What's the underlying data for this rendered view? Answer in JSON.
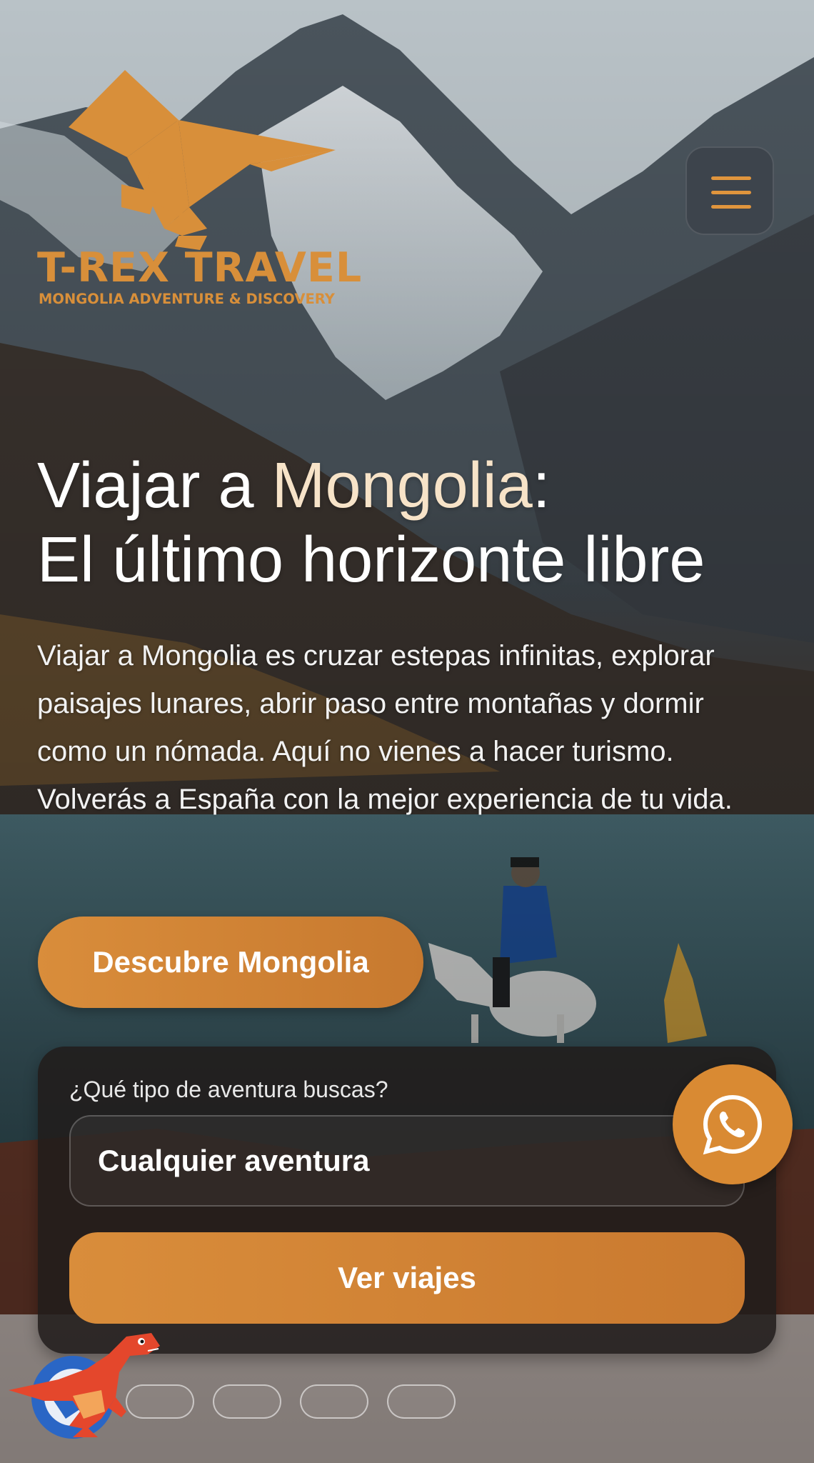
{
  "brand": {
    "name": "T-REX TRAVEL",
    "tagline": "MONGOLIA ADVENTURE & DISCOVERY",
    "color": "#d88f3a"
  },
  "header": {
    "menu_icon": "hamburger-icon"
  },
  "hero": {
    "headline_part1": "Viajar a ",
    "headline_accent": "Mongolia",
    "headline_part2": ":",
    "headline_line2": "El último horizonte libre",
    "intro": "Viajar a Mongolia es cruzar estepas infinitas, explorar paisajes lunares, abrir paso entre montañas y dormir como un nómada. Aquí no vienes a hacer turismo. Volverás a España con la mejor experiencia de tu vida.",
    "cta_label": "Descubre Mongolia"
  },
  "search": {
    "label": "¿Qué tipo de aventura buscas?",
    "selected_value": "Cualquier aventura",
    "button_label": "Ver viajes"
  },
  "floating": {
    "whatsapp_icon": "whatsapp-icon",
    "mascot_icon": "trex-mascot-icon"
  },
  "carousel": {
    "dot_count": 4
  },
  "colors": {
    "accent": "#d98d3b",
    "accent_light": "#f7e3c8",
    "card_bg": "#211c1b"
  }
}
